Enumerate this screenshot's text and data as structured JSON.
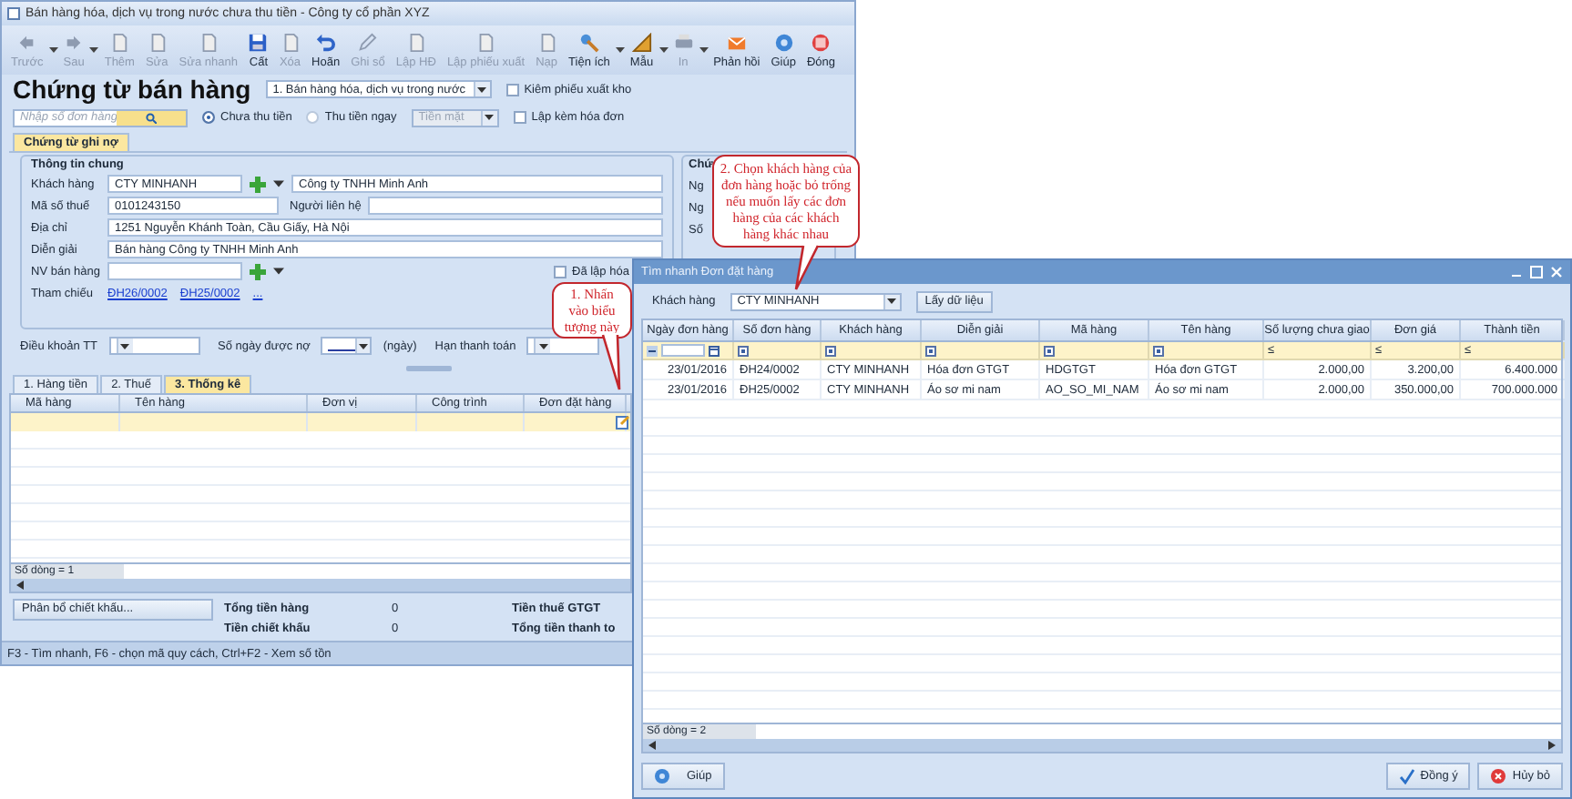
{
  "main_window": {
    "title": "Bán hàng hóa, dịch vụ trong nước chưa thu tiền - Công ty cổ phần XYZ",
    "toolbar": [
      {
        "label": "Trước",
        "disabled": true,
        "dropdown": true
      },
      {
        "label": "Sau",
        "disabled": true,
        "dropdown": true
      },
      {
        "label": "Thêm",
        "disabled": true,
        "dropdown": false
      },
      {
        "label": "Sửa",
        "disabled": true,
        "dropdown": false
      },
      {
        "label": "Sửa nhanh",
        "disabled": true,
        "dropdown": false
      },
      {
        "label": "Cất",
        "disabled": false,
        "dropdown": false
      },
      {
        "label": "Xóa",
        "disabled": true,
        "dropdown": false
      },
      {
        "label": "Hoãn",
        "disabled": false,
        "dropdown": false
      },
      {
        "label": "Ghi sổ",
        "disabled": true,
        "dropdown": false
      },
      {
        "label": "Lập HĐ",
        "disabled": true,
        "dropdown": false
      },
      {
        "label": "Lập phiếu xuất",
        "disabled": true,
        "dropdown": false
      },
      {
        "label": "Nạp",
        "disabled": true,
        "dropdown": false
      },
      {
        "label": "Tiện ích",
        "disabled": false,
        "dropdown": true
      },
      {
        "label": "Mẫu",
        "disabled": false,
        "dropdown": true
      },
      {
        "label": "In",
        "disabled": true,
        "dropdown": true
      },
      {
        "label": "Phản hồi",
        "disabled": false,
        "dropdown": false
      },
      {
        "label": "Giúp",
        "disabled": false,
        "dropdown": false
      },
      {
        "label": "Đóng",
        "disabled": false,
        "dropdown": false
      }
    ],
    "heading": "Chứng từ bán hàng",
    "voucher_type": "1. Bán hàng hóa, dịch vụ trong nước",
    "export_slip": {
      "label": "Kiêm phiếu xuất kho",
      "checked": false
    },
    "search": {
      "placeholder": "Nhập số đơn hàng"
    },
    "payment_options": [
      {
        "label": "Chưa thu tiền",
        "selected": true
      },
      {
        "label": "Thu tiền ngay",
        "selected": false
      }
    ],
    "payment_method": {
      "value": "Tiền mặt",
      "disabled": true
    },
    "invoice_option": {
      "label": "Lập kèm hóa đơn",
      "checked": false
    },
    "tabs": [
      {
        "label": "Chứng từ ghi nợ",
        "selected": true
      }
    ],
    "general_info": {
      "title": "Thông tin chung",
      "customer_label": "Khách hàng",
      "customer_code": "CTY MINHANH",
      "customer_name": "Công ty TNHH Minh Anh",
      "tax_label": "Mã số thuế",
      "tax_code": "0101243150",
      "contact_label": "Người liên hệ",
      "address_label": "Địa chỉ",
      "address": "1251 Nguyễn Khánh Toàn, Cầu Giấy, Hà Nội",
      "description_label": "Diễn giải",
      "description": "Bán hàng Công ty TNHH Minh Anh",
      "salesperson_label": "NV bán hàng",
      "reference_label": "Tham chiếu",
      "references": [
        "ĐH26/0002",
        "ĐH25/0002",
        "..."
      ],
      "invoiced": {
        "label": "Đã lập hóa",
        "checked": false
      }
    },
    "voucher_info": {
      "title": "Chứ",
      "labels": [
        "Ng",
        "Ng",
        "Số"
      ]
    },
    "terms": {
      "payment_terms_label": "Điều khoản TT",
      "days_label": "Số ngày được nợ",
      "days_unit": "(ngày)",
      "due_label": "Hạn thanh toán"
    },
    "detail_tabs": [
      {
        "label": "1. Hàng tiền",
        "selected": false
      },
      {
        "label": "2. Thuế",
        "selected": false
      },
      {
        "label": "3. Thống kê",
        "selected": true
      }
    ],
    "grid": {
      "columns": [
        "Mã hàng",
        "Tên hàng",
        "Đơn vị",
        "Công trình",
        "Đơn đặt hàng"
      ],
      "rows": [
        {
          "selected": true
        }
      ],
      "row_count": "Số dòng = 1"
    },
    "discount_button": "Phân bổ chiết khấu...",
    "totals": [
      {
        "label": "Tổng tiền hàng",
        "value": "0"
      },
      {
        "label": "Tiền chiết khấu",
        "value": "0"
      }
    ],
    "totals_right": [
      "Tiền thuế GTGT",
      "Tổng tiền thanh to"
    ],
    "status_bar": "F3 - Tìm nhanh, F6 - chọn mã quy cách, Ctrl+F2 - Xem số tồn"
  },
  "dialog": {
    "title": "Tìm nhanh Đơn đặt hàng",
    "customer_label": "Khách hàng",
    "customer": "CTY MINHANH",
    "load_button": "Lấy dữ liệu",
    "columns": [
      {
        "label": "Ngày đơn hàng",
        "kind": "date"
      },
      {
        "label": "Số đơn hàng",
        "kind": "text"
      },
      {
        "label": "Khách hàng",
        "kind": "text"
      },
      {
        "label": "Diễn giải",
        "kind": "text"
      },
      {
        "label": "Mã hàng",
        "kind": "text"
      },
      {
        "label": "Tên hàng",
        "kind": "text"
      },
      {
        "label": "Số lượng chưa giao",
        "kind": "number",
        "filter": "≤"
      },
      {
        "label": "Đơn giá",
        "kind": "number",
        "filter": "≤"
      },
      {
        "label": "Thành tiền",
        "kind": "number",
        "filter": "≤"
      }
    ],
    "rows": [
      [
        "23/01/2016",
        "ĐH24/0002",
        "CTY MINHANH",
        "Hóa đơn GTGT",
        "HDGTGT",
        "Hóa đơn GTGT",
        "2.000,00",
        "3.200,00",
        "6.400.000"
      ],
      [
        "23/01/2016",
        "ĐH25/0002",
        "CTY MINHANH",
        "Áo sơ mi nam",
        "AO_SO_MI_NAM",
        "Áo sơ mi nam",
        "2.000,00",
        "350.000,00",
        "700.000.000"
      ]
    ],
    "row_count": "Số dòng = 2",
    "help_button": "Giúp",
    "ok_button": "Đồng ý",
    "cancel_button": "Hủy bỏ"
  },
  "callouts": [
    {
      "text": "1. Nhấn vào biểu tượng này"
    },
    {
      "text": "2. Chọn khách hàng của đơn hàng hoặc bỏ trống nếu muốn lấy các đơn hàng của các khách hàng khác nhau"
    }
  ]
}
